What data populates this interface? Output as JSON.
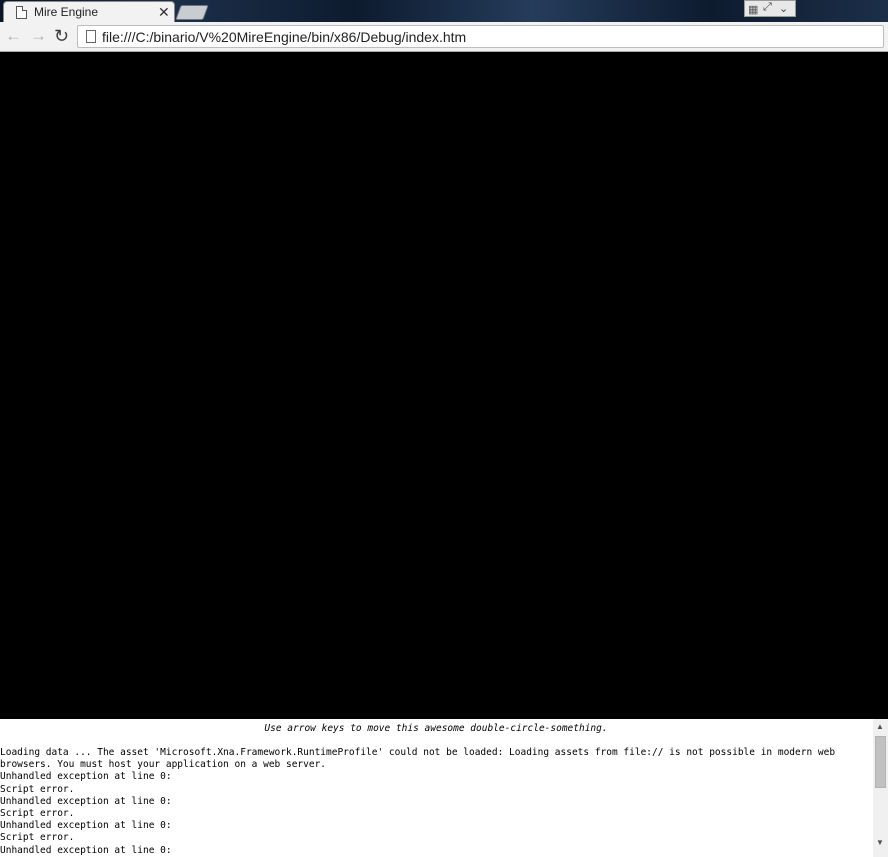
{
  "tab": {
    "title": "Mire Engine",
    "close_glyph": "✕",
    "favicon": "page-icon"
  },
  "window": {
    "controls": [
      "grid-icon",
      "expand-icon",
      "chevron-down-icon"
    ]
  },
  "toolbar": {
    "back_glyph": "←",
    "forward_glyph": "→",
    "reload_glyph": "↻",
    "url": "file:///C:/binario/V%20MireEngine/bin/x86/Debug/index.htm"
  },
  "canvas": {
    "background": "#000000"
  },
  "console": {
    "hint": "Use arrow keys to move this awesome double-circle-something.",
    "lines": [
      "Loading data ... The asset 'Microsoft.Xna.Framework.RuntimeProfile' could not be loaded: Loading assets from file:// is not possible in modern web",
      "browsers. You must host your application on a web server.",
      "Unhandled exception at line 0:",
      "Script error.",
      "Unhandled exception at line 0:",
      "Script error.",
      "Unhandled exception at line 0:",
      "Script error.",
      "Unhandled exception at line 0:"
    ]
  }
}
